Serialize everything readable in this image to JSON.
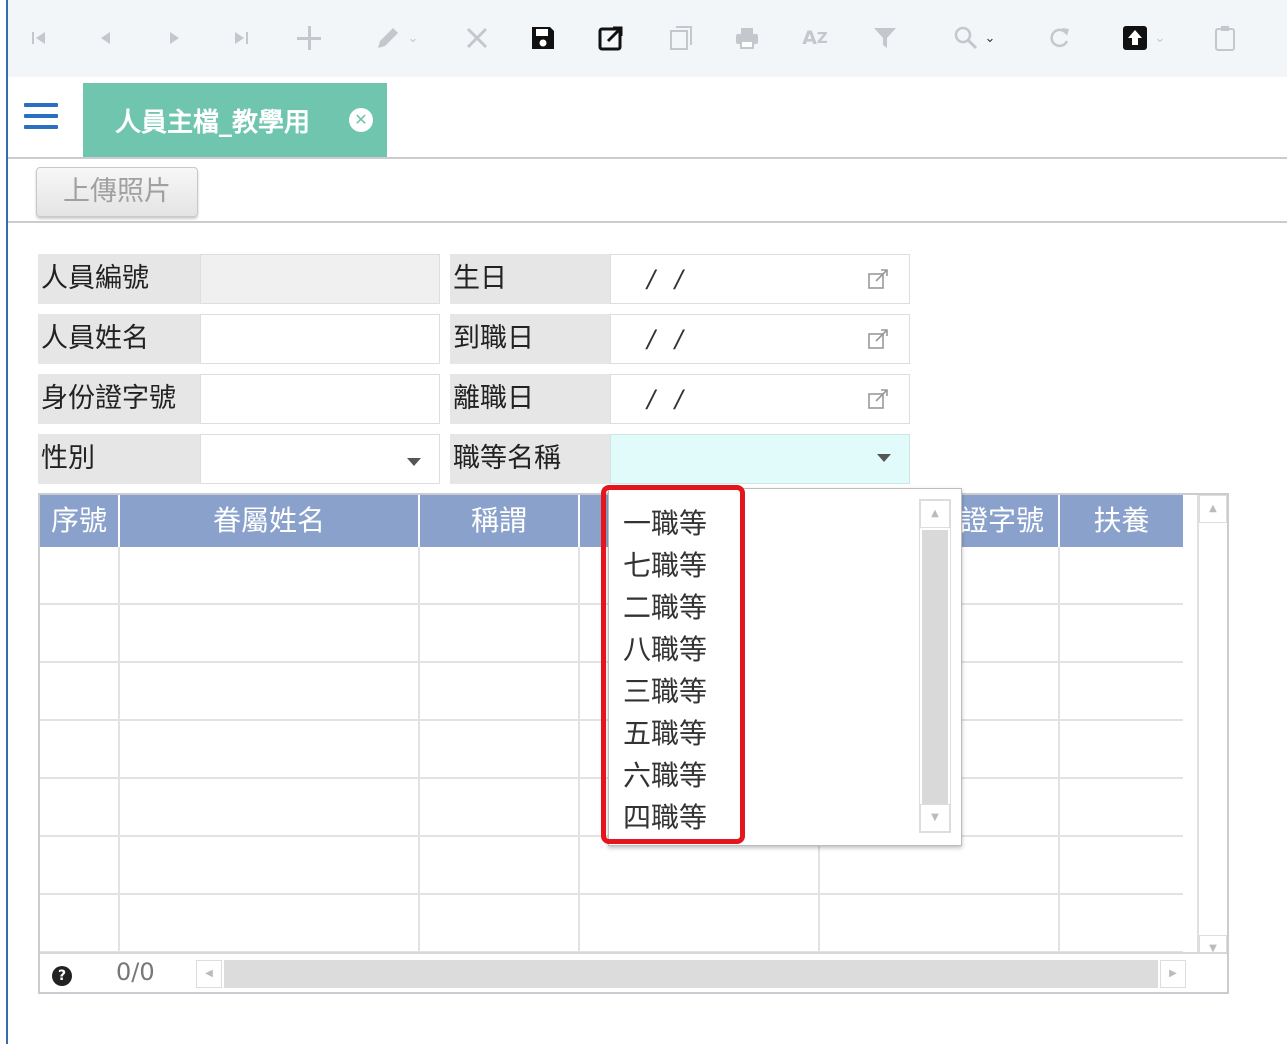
{
  "toolbar": {
    "icons": [
      "first-record-icon",
      "prev-record-icon",
      "next-record-icon",
      "last-record-icon",
      "add-icon",
      "edit-icon",
      "delete-icon",
      "save-icon",
      "export-icon",
      "copy-icon",
      "print-icon",
      "sort-icon",
      "filter-icon",
      "search-icon",
      "refresh-icon",
      "upload-icon",
      "clipboard-icon"
    ]
  },
  "tabs": [
    {
      "label": "人員主檔_教學用"
    }
  ],
  "actions": {
    "upload_photo": "上傳照片"
  },
  "form": {
    "emp_no_label": "人員編號",
    "emp_no_value": "",
    "emp_name_label": "人員姓名",
    "emp_name_value": "",
    "id_no_label": "身份證字號",
    "id_no_value": "",
    "gender_label": "性別",
    "gender_value": "",
    "birthday_label": "生日",
    "birthday_value": "/ /",
    "hire_date_label": "到職日",
    "hire_date_value": "/ /",
    "leave_date_label": "離職日",
    "leave_date_value": "/ /",
    "grade_label": "職等名稱",
    "grade_value": ""
  },
  "grid": {
    "columns": [
      "序號",
      "眷屬姓名",
      "稱謂",
      "",
      "證字號",
      "扶養"
    ],
    "row_count": 7,
    "record_counter": "0/0"
  },
  "grade_dropdown": {
    "options": [
      "一職等",
      "七職等",
      "二職等",
      "八職等",
      "三職等",
      "五職等",
      "六職等",
      "四職等"
    ],
    "highlight_color": "#e4151d"
  },
  "colors": {
    "accent_tab": "#6fc5ae",
    "grid_header": "#8aa2cb",
    "menu_icon": "#2a6fc2"
  }
}
